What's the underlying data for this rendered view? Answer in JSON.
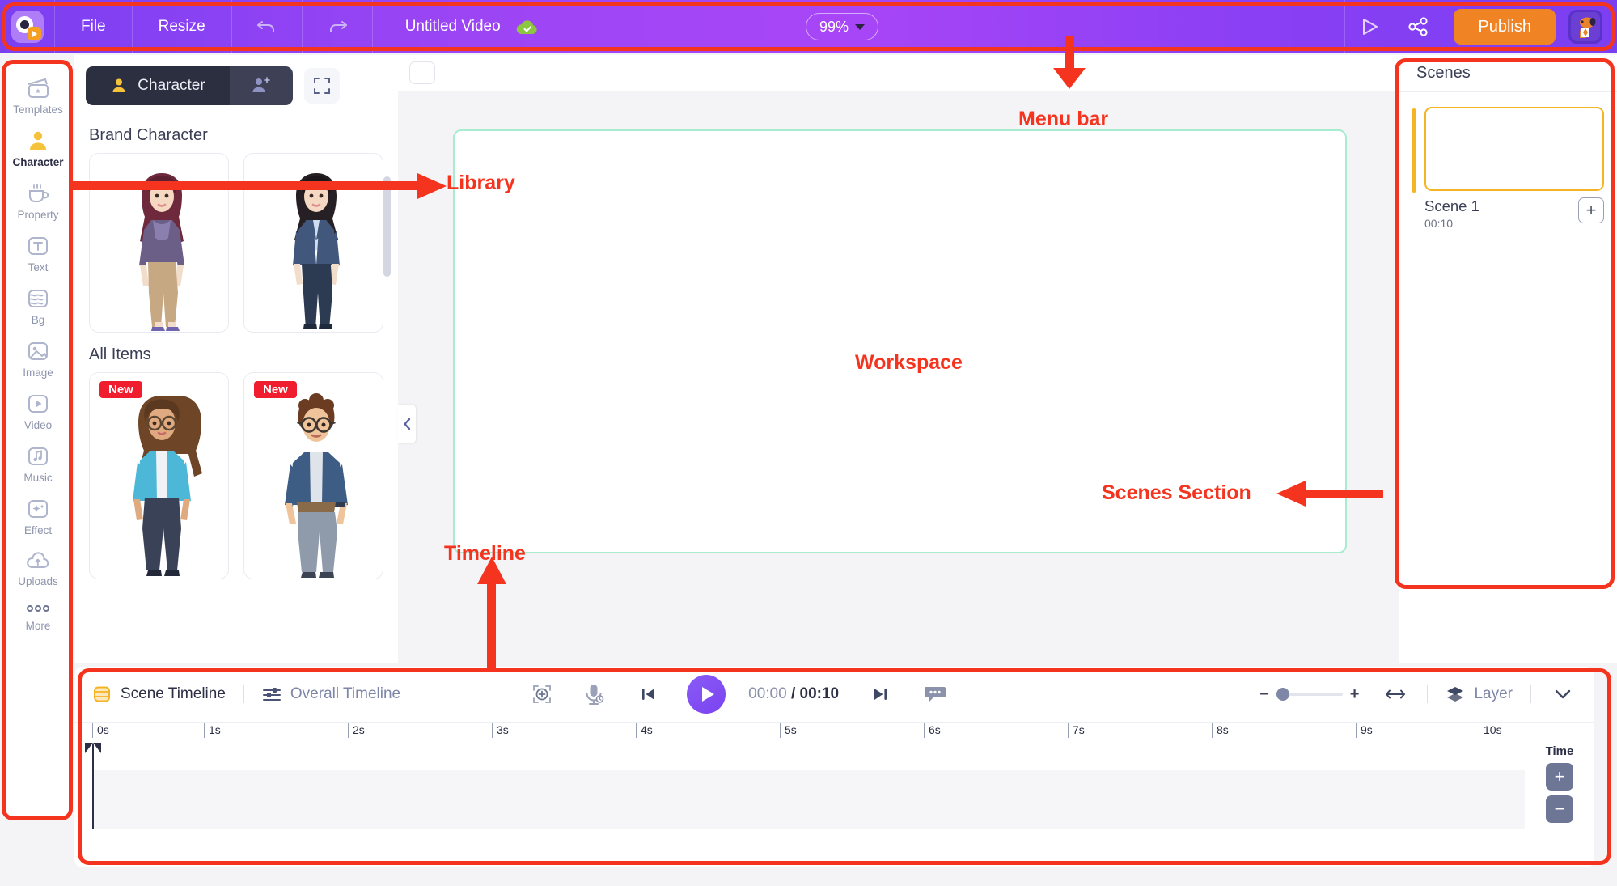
{
  "menu_bar": {
    "logo_icon": "animaker-logo-icon",
    "items": [
      {
        "label": "File",
        "name": "menu-file"
      },
      {
        "label": "Resize",
        "name": "menu-resize"
      }
    ],
    "undo_icon": "undo-icon",
    "redo_icon": "redo-icon",
    "project_title": "Untitled Video",
    "saved_icon": "cloud-saved-icon",
    "zoom_level": "99%",
    "preview_icon": "play-preview-icon",
    "share_icon": "share-icon",
    "publish_label": "Publish",
    "avatar_icon": "user-avatar"
  },
  "rail": {
    "items": [
      {
        "label": "Templates",
        "icon": "templates-icon",
        "active": false
      },
      {
        "label": "Character",
        "icon": "character-icon",
        "active": true
      },
      {
        "label": "Property",
        "icon": "property-icon",
        "active": false
      },
      {
        "label": "Text",
        "icon": "text-icon",
        "active": false
      },
      {
        "label": "Bg",
        "icon": "background-icon",
        "active": false
      },
      {
        "label": "Image",
        "icon": "image-icon",
        "active": false
      },
      {
        "label": "Video",
        "icon": "video-icon",
        "active": false
      },
      {
        "label": "Music",
        "icon": "music-icon",
        "active": false
      },
      {
        "label": "Effect",
        "icon": "effect-icon",
        "active": false
      },
      {
        "label": "Uploads",
        "icon": "uploads-icon",
        "active": false
      },
      {
        "label": "More",
        "icon": "more-icon",
        "active": false
      }
    ]
  },
  "library": {
    "tab_label": "Character",
    "tab_icon": "person-icon",
    "add_character_icon": "person-add-icon",
    "expand_icon": "expand-icon",
    "sections": [
      {
        "title": "Brand Character",
        "items": [
          {
            "badge": "",
            "alt": "brand-character-1"
          },
          {
            "badge": "",
            "alt": "brand-character-2"
          }
        ]
      },
      {
        "title": "All Items",
        "items": [
          {
            "badge": "New",
            "alt": "character-woman-glasses"
          },
          {
            "badge": "New",
            "alt": "character-man-glasses"
          }
        ]
      }
    ],
    "collapse_icon": "chevron-left-icon"
  },
  "scenes": {
    "title": "Scenes",
    "list": [
      {
        "name": "Scene 1",
        "duration": "00:10"
      }
    ],
    "add_scene_label": "+",
    "accent_color": "#f5b423"
  },
  "timeline": {
    "scene_tab": "Scene Timeline",
    "scene_tab_icon": "scene-timeline-icon",
    "overall_tab": "Overall Timeline",
    "overall_tab_icon": "overall-timeline-icon",
    "fit_icon": "fit-to-screen-icon",
    "mic_icon": "record-voice-icon",
    "prev_icon": "skip-previous-icon",
    "play_icon": "play-icon",
    "next_icon": "skip-next-icon",
    "subtitle_icon": "subtitle-icon",
    "current_time": "00:00",
    "separator": "/",
    "total_time": "00:10",
    "zoom_minus": "−",
    "zoom_plus": "+",
    "fit_width_icon": "fit-width-icon",
    "layer_label": "Layer",
    "layer_icon": "layers-icon",
    "chevron_icon": "chevron-down-icon",
    "ruler_ticks": [
      "0s",
      "1s",
      "2s",
      "3s",
      "4s",
      "5s",
      "6s",
      "7s",
      "8s",
      "9s",
      "10s"
    ],
    "time_control_label": "Time",
    "time_plus": "+",
    "time_minus": "−"
  },
  "annotations": {
    "accent_color": "#f4341f",
    "labels": [
      {
        "text": "Menu bar",
        "name": "annotation-menu-bar"
      },
      {
        "text": "Library",
        "name": "annotation-library"
      },
      {
        "text": "Workspace",
        "name": "annotation-workspace"
      },
      {
        "text": "Scenes Section",
        "name": "annotation-scenes-section"
      },
      {
        "text": "Timeline",
        "name": "annotation-timeline"
      }
    ]
  }
}
